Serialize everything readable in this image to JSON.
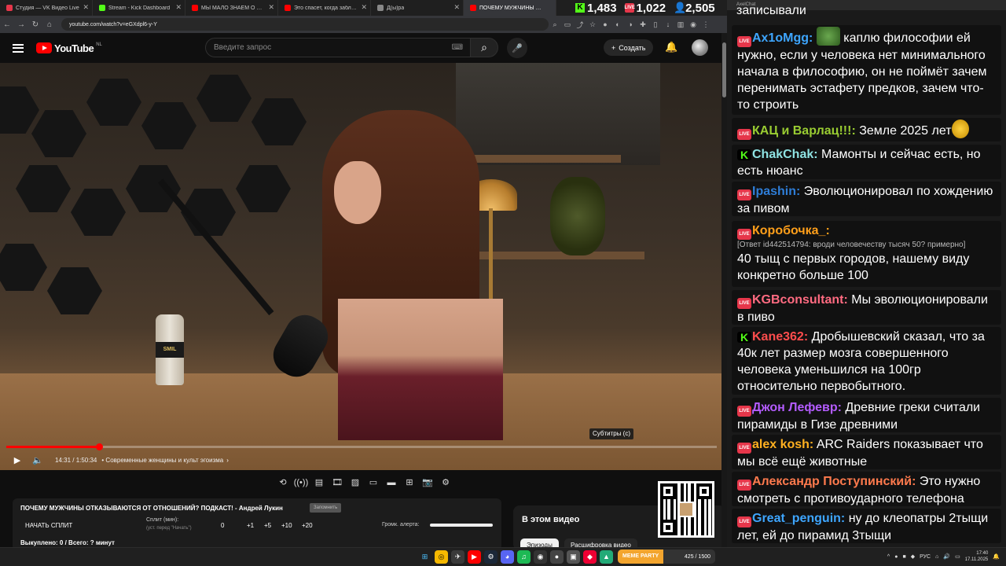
{
  "browser": {
    "tabs": [
      {
        "title": "Студия — VK Видео Live",
        "icon": "vk",
        "active": false
      },
      {
        "title": "Stream - Kick Dashboard",
        "icon": "kick",
        "active": false
      },
      {
        "title": "МЫ МАЛО ЗНАЕМ О ЧАТРУЛЕТЕ",
        "icon": "yt",
        "active": false
      },
      {
        "title": "Это спасет, когда заблокируют",
        "icon": "yt",
        "active": false
      },
      {
        "title": "Д(ы)ра",
        "icon": "other",
        "active": false
      },
      {
        "title": "ПОЧЕМУ МУЖЧИНЫ ОТКАЗЫВАЮТСЯ",
        "icon": "yt",
        "active": true
      }
    ],
    "url": "youtube.com/watch?v=eGXdpl6-y-Y"
  },
  "stats": {
    "kick_viewers": "1,483",
    "vk_viewers": "1,022",
    "total_viewers": "2,505"
  },
  "youtube": {
    "logo_text": "YouTube",
    "region": "NL",
    "search_placeholder": "Введите запрос",
    "create_label": "Создать",
    "player": {
      "time": "14:31 / 1:50:34",
      "chapter": "• Современные женщины и культ эгоизма",
      "tooltip": "Субтитры (c)",
      "progress": 0.13,
      "bottle_label": "SMIL"
    },
    "in_this_video": {
      "heading": "В этом видео",
      "chips": [
        "Эпизоды",
        "Расшифровка видео"
      ]
    }
  },
  "overlay_panel": {
    "title": "ПОЧЕМУ МУЖЧИНЫ ОТКАЗЫВАЮТСЯ ОТ ОТНОШЕНИЙ? ПОДКАСТ! - Андрей Лукин",
    "button": "Запомнить",
    "split_button": "НАЧАТЬ СПЛИТ",
    "split_label": "Сплит (мин):",
    "split_hint": "(уст. перед \"Начать\")",
    "split_values": [
      "0",
      "+1",
      "+5",
      "+10",
      "+20"
    ],
    "alert_label": "Громк. алерта:",
    "bought": "Выкуплено: 0 / Всего: ? минут"
  },
  "taskbar": {
    "meme_label": "MEME PARTY",
    "meme_count": "425 / 1500",
    "lang": "РУС",
    "time": "17:40",
    "date": "17.11.2025"
  },
  "chat": {
    "window_title": "AxelChat",
    "cut_text": "записывали",
    "messages": [
      {
        "platform": "vk",
        "name": "Ax1oMgg:",
        "color": "#3ea6ff",
        "text": "каплю философии ей нужно, если у человека нет минимального начала в философию, он не поймёт зачем перенимать эстафету предков, зачем что-то строить",
        "emote": "frog"
      },
      {
        "platform": "vk",
        "name": "КАЦ и Варлац!!!:",
        "color": "#9acd32",
        "text": "Земле 2025 лет",
        "emote": "bee"
      },
      {
        "platform": "kick",
        "name": "ChakChak:",
        "color": "#8fe3e3",
        "text": "Мамонты и сейчас есть, но есть нюанс"
      },
      {
        "platform": "vk",
        "name": "Ipashin:",
        "color": "#2e7dd7",
        "text": "Эволюционировал по хождению за пивом"
      },
      {
        "platform": "vk",
        "name": "Коробочка_:",
        "color": "#ff9f1a",
        "reply": "[Ответ id442514794: вроди человечеству тысяч 50? примерно]",
        "text": "40 тыщ с первых городов, нашему виду конкретно больше 100"
      },
      {
        "platform": "vk",
        "name": "KGBconsultant:",
        "color": "#ff6b81",
        "text": "Мы эволюционировали в пиво"
      },
      {
        "platform": "kick",
        "name": "Kane362:",
        "color": "#ff4d4d",
        "text": "Дробышевский сказал, что за 40к лет размер мозга совершенного человека уменьшился на 100гр относительно первобытного."
      },
      {
        "platform": "vk",
        "name": "Джон Лефевр:",
        "color": "#b45cff",
        "text": "Древние греки считали пирамиды в Гизе древними"
      },
      {
        "platform": "vk",
        "name": "alex kosh:",
        "color": "#ffb020",
        "text": "ARC Raiders показывает что мы всё ещё животные"
      },
      {
        "platform": "vk",
        "name": "Александр Поступинский:",
        "color": "#ff7a4d",
        "text": "Это нужно смотреть с противоударного телефона"
      },
      {
        "platform": "vk",
        "name": "Great_penguin:",
        "color": "#3ea6ff",
        "text": "ну до клеопатры 2тыщи лет, ей до пирамид 3тыщи"
      }
    ]
  },
  "colors": {
    "accent_red": "#ff0000",
    "kick_green": "#53fc18",
    "vk_red": "#e6364a"
  }
}
